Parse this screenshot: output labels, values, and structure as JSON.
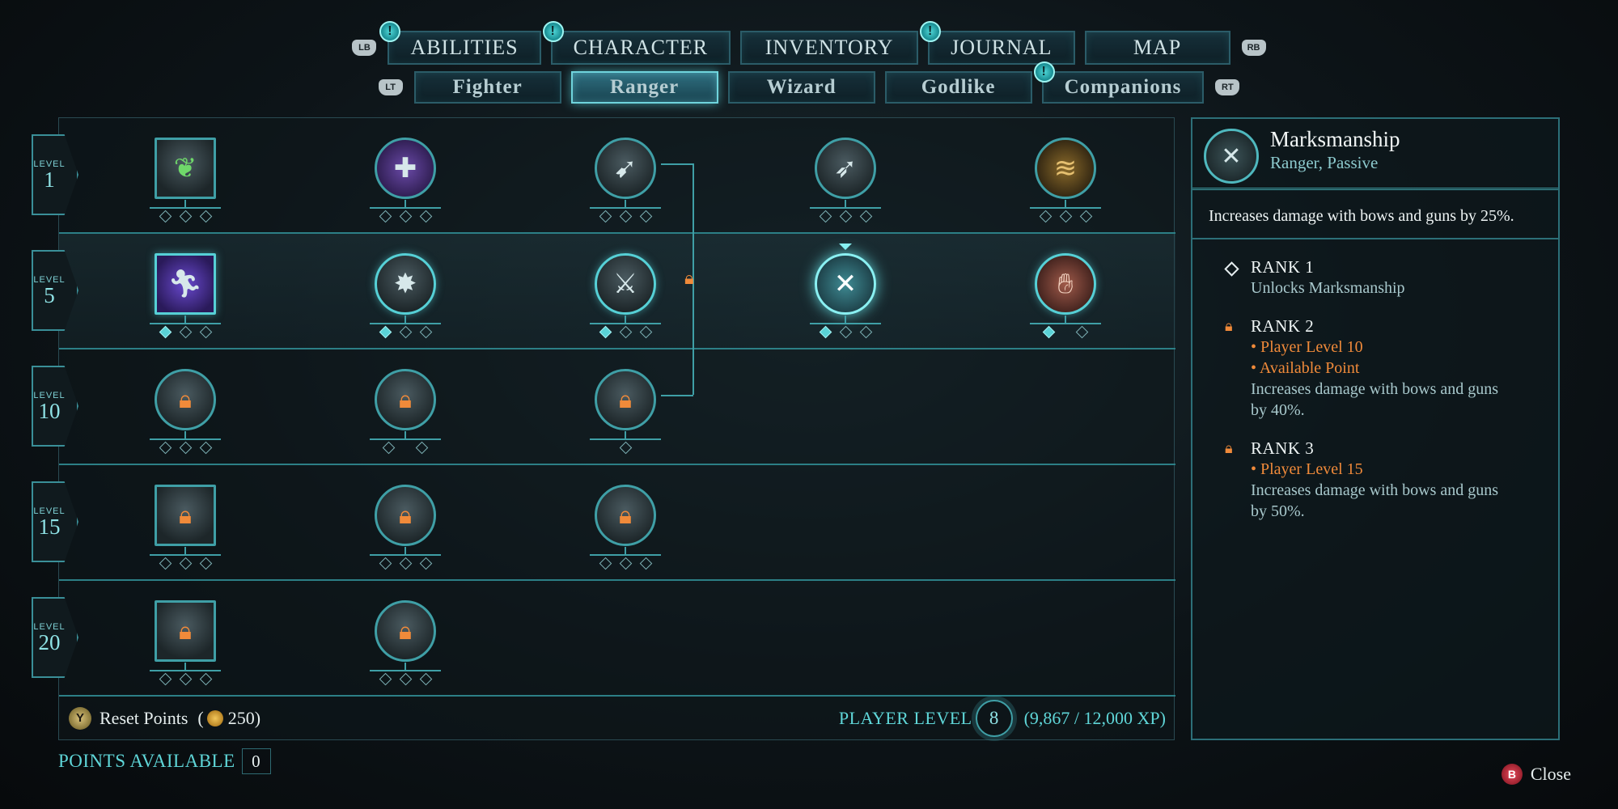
{
  "main_tabs": [
    {
      "label": "ABILITIES",
      "notification": true
    },
    {
      "label": "CHARACTER",
      "notification": true
    },
    {
      "label": "INVENTORY",
      "notification": false
    },
    {
      "label": "JOURNAL",
      "notification": true
    },
    {
      "label": "MAP",
      "notification": false
    }
  ],
  "main_bumpers": {
    "left": "LB",
    "right": "RB"
  },
  "sub_tabs": [
    {
      "label": "Fighter",
      "active": false,
      "notification": false
    },
    {
      "label": "Ranger",
      "active": true,
      "notification": false
    },
    {
      "label": "Wizard",
      "active": false,
      "notification": false
    },
    {
      "label": "Godlike",
      "active": false,
      "notification": false
    },
    {
      "label": "Companions",
      "active": false,
      "notification": true
    }
  ],
  "sub_bumpers": {
    "left": "LT",
    "right": "RT"
  },
  "notification_glyph": "!",
  "tiers": [
    {
      "level_label": "LEVEL",
      "level": "1"
    },
    {
      "level_label": "LEVEL",
      "level": "5"
    },
    {
      "level_label": "LEVEL",
      "level": "10"
    },
    {
      "level_label": "LEVEL",
      "level": "15"
    },
    {
      "level_label": "LEVEL",
      "level": "20"
    }
  ],
  "footer": {
    "reset_button": "Y",
    "reset_label": "Reset Points",
    "reset_open": "(",
    "reset_cost": "250",
    "reset_close": ")",
    "player_level_label": "PLAYER LEVEL",
    "player_level": "8",
    "xp": "(9,867 / 12,000 XP)"
  },
  "points_available": {
    "label": "POINTS AVAILABLE",
    "value": "0"
  },
  "close": {
    "button": "B",
    "label": "Close"
  },
  "detail": {
    "icon": "crossed-arrows-icon",
    "title": "Marksmanship",
    "subtitle": "Ranger, Passive",
    "description": "Increases damage with bows and guns by 25%.",
    "ranks": [
      {
        "title": "RANK 1",
        "state": "unlocked",
        "requirements": [],
        "text": "Unlocks Marksmanship"
      },
      {
        "title": "RANK 2",
        "state": "locked",
        "requirements": [
          "• Player Level 10",
          "• Available Point"
        ],
        "text": "Increases damage with bows and guns by 40%."
      },
      {
        "title": "RANK 3",
        "state": "locked",
        "requirements": [
          "• Player Level 15"
        ],
        "text": "Increases damage with bows and guns by 50%."
      }
    ]
  },
  "colors": {
    "accent": "#3f9fa6",
    "locked": "#f08a3a",
    "selected_glow": "#8af0f2"
  }
}
